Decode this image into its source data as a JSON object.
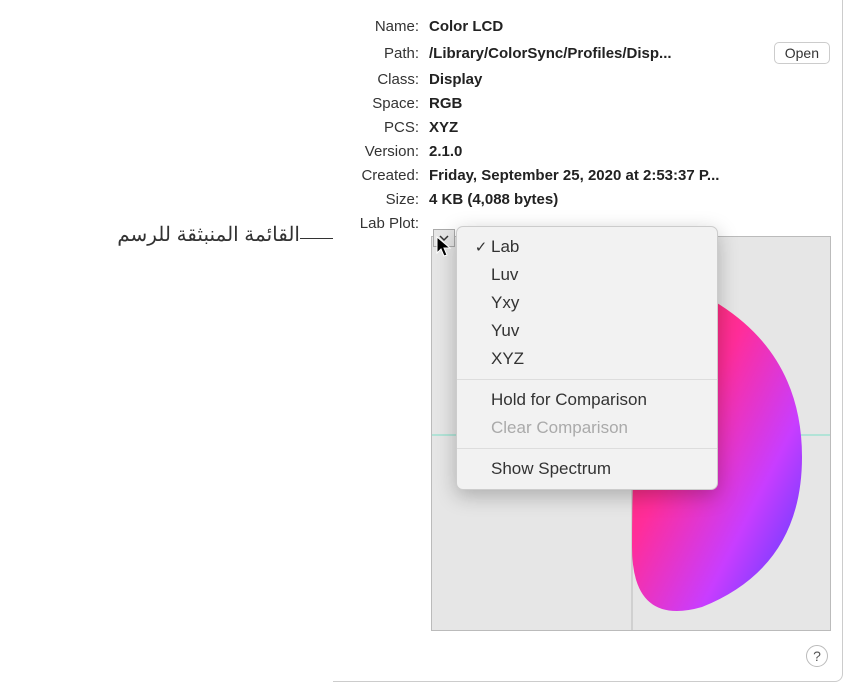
{
  "annotation": "القائمة المنبثقة للرسم",
  "info": {
    "name": {
      "label": "Name:",
      "value": "Color LCD"
    },
    "path": {
      "label": "Path:",
      "value": "/Library/ColorSync/Profiles/Disp..."
    },
    "class": {
      "label": "Class:",
      "value": "Display"
    },
    "space": {
      "label": "Space:",
      "value": "RGB"
    },
    "pcs": {
      "label": "PCS:",
      "value": "XYZ"
    },
    "version": {
      "label": "Version:",
      "value": "2.1.0"
    },
    "created": {
      "label": "Created:",
      "value": "Friday, September 25, 2020 at 2:53:37 P..."
    },
    "size": {
      "label": "Size:",
      "value": "4 KB (4,088 bytes)"
    },
    "labplot": {
      "label": "Lab Plot:"
    }
  },
  "open_btn": "Open",
  "popup": {
    "lab": "Lab",
    "luv": "Luv",
    "yxy": "Yxy",
    "yuv": "Yuv",
    "xyz": "XYZ",
    "hold": "Hold for Comparison",
    "clear": "Clear Comparison",
    "spectrum": "Show Spectrum"
  },
  "help": "?"
}
